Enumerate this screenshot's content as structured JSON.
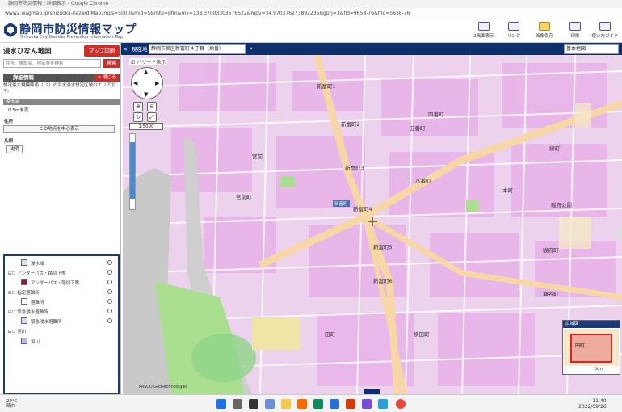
{
  "browser": {
    "title": "静岡市防災情報 | 詳細表示 - Google Chrome",
    "url": "www2.wagmap.jp/shizuoka-hazard/Map?mps=5000&mid=5&mtp=pfm&mx=138.37003303576522&mpy=34.970376273892235&gprj=3&fid=9658-76&ffid=5658-76"
  },
  "header": {
    "title": "静岡市防災情報マップ",
    "subtitle": "Shizuoka City Disaster Prevention Information Map",
    "buttons": [
      {
        "label": "2画面表示",
        "icon": "dual-screen-icon"
      },
      {
        "label": "リンク",
        "icon": "link-icon"
      },
      {
        "label": "画像保存",
        "icon": "folder-icon"
      },
      {
        "label": "印刷",
        "icon": "print-icon"
      },
      {
        "label": "使い方ガイド",
        "icon": "guide-icon"
      }
    ]
  },
  "toolbar": {
    "current_label": "現在地",
    "current_value": "静岡市葵区新富町４丁目（地番）",
    "basemap_value": "基本地図"
  },
  "sidebar": {
    "title": "浸水ひなん地図",
    "map_download": "マップ印刷",
    "search_placeholder": "住所、施設名、地名等を検索",
    "search_button": "検索",
    "detail_header": "詳細情報",
    "detail_close": "× 閉じる",
    "detail_text": "想定最大規模降雨（L2）の洪水浸水想定区域のエリアです。",
    "depth_header": "浸水深",
    "depth_value": "0.5m未満",
    "address_label": "住所",
    "center_button": "この地点を中心表示",
    "legend_label": "凡例",
    "legend_button": "説明"
  },
  "layers": [
    {
      "label": "浸水域",
      "indent": 1
    },
    {
      "label": "アンダーパス・踏切下等",
      "indent": 0
    },
    {
      "label": "アンダーパス・踏切下等",
      "indent": 1
    },
    {
      "label": "指定避難所",
      "indent": 0
    },
    {
      "label": "避難所",
      "indent": 1
    },
    {
      "label": "緊急浸水避難所",
      "indent": 0
    },
    {
      "label": "緊急浸水避難所",
      "indent": 1
    },
    {
      "label": "河川",
      "indent": 0
    },
    {
      "label": "河川",
      "indent": 1
    }
  ],
  "map": {
    "checkbox_label": "ハザード表示",
    "scale": "1:5000",
    "overview_title": "広域図",
    "overview_place": "田町",
    "overview_scale": "1km",
    "attribution": "PASCO  GeoTechnologies",
    "labels": [
      "新富町1",
      "新富町3",
      "新富町4",
      "新富町5",
      "新富町6",
      "新富町2",
      "宮前町",
      "五番町",
      "四番町",
      "八番町",
      "本町",
      "駿府町",
      "田町",
      "横田町",
      "瀬名町",
      "緑町",
      "新富町",
      "宮前",
      "駿府公園"
    ]
  },
  "taskbar": {
    "weather_temp": "29°C",
    "weather_desc": "晴れ",
    "time": "11:40",
    "date": "2022/09/26"
  }
}
